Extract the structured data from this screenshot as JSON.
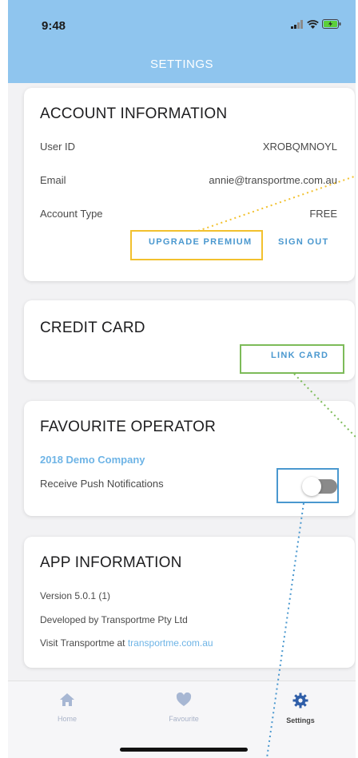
{
  "status_bar": {
    "time": "9:48"
  },
  "nav": {
    "title": "SETTINGS"
  },
  "account": {
    "title": "ACCOUNT INFORMATION",
    "user_id_label": "User ID",
    "user_id_value": "XROBQMNOYL",
    "email_label": "Email",
    "email_value": "annie@transportme.com.au",
    "account_type_label": "Account Type",
    "account_type_value": "FREE",
    "upgrade_label": "UPGRADE PREMIUM",
    "signout_label": "SIGN OUT"
  },
  "credit_card": {
    "title": "CREDIT CARD",
    "link_label": "LINK CARD"
  },
  "operator": {
    "title": "FAVOURITE OPERATOR",
    "company": "2018 Demo Company",
    "push_label": "Receive Push Notifications",
    "push_enabled": false
  },
  "app_info": {
    "title": "APP INFORMATION",
    "version": "Version 5.0.1 (1)",
    "developer": "Developed by Transportme Pty Ltd",
    "visit_prefix": "Visit Transportme at",
    "visit_link": "transportme.com.au"
  },
  "tabs": [
    {
      "label": "Home",
      "icon": "home-icon",
      "active": false
    },
    {
      "label": "Favourite",
      "icon": "heart-icon",
      "active": false
    },
    {
      "label": "Settings",
      "icon": "gear-icon",
      "active": true
    }
  ],
  "colors": {
    "header": "#8fc5ee",
    "link": "#4a98cf",
    "highlight_upgrade": "#f2c12e",
    "highlight_link_card": "#7dbb59",
    "highlight_toggle": "#4a98cf"
  }
}
